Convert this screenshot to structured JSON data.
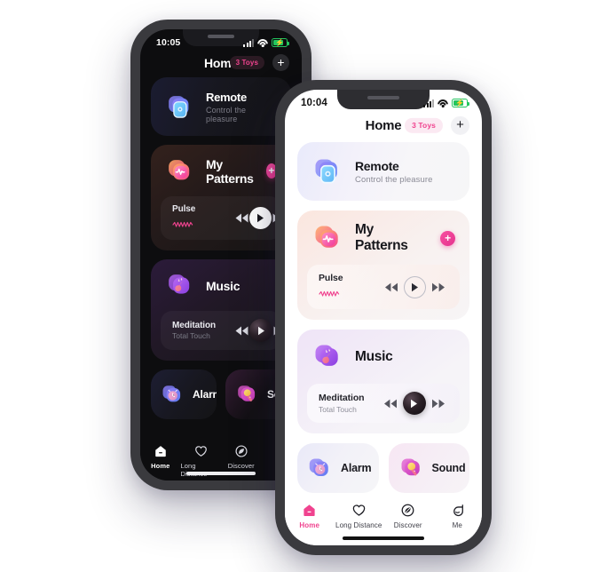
{
  "scene": {
    "background": "#ffffff",
    "accent_pink": "#f0438f",
    "description": "Two iPhone mockups of a toy-control app home screen, dark variant behind and light variant in front"
  },
  "phones": [
    {
      "id": "back-phone",
      "theme": "dark",
      "status": {
        "time": "10:05",
        "signal_icon": "cellular-bars-icon",
        "wifi_icon": "wifi-icon",
        "battery_icon": "battery-charging-icon"
      },
      "header": {
        "title": "Home",
        "badge": "3 Toys",
        "add_label": "+"
      }
    },
    {
      "id": "front-phone",
      "theme": "light",
      "status": {
        "time": "10:04",
        "signal_icon": "cellular-bars-icon",
        "wifi_icon": "wifi-icon",
        "battery_icon": "battery-charging-icon"
      },
      "header": {
        "title": "Home",
        "badge": "3 Toys",
        "add_label": "+"
      }
    }
  ],
  "cards": {
    "remote": {
      "title": "Remote",
      "subtitle": "Control the pleasure",
      "icon": "remote-device-icon"
    },
    "patterns": {
      "title": "My Patterns",
      "icon": "pulse-heartbeat-icon",
      "add_label": "+",
      "player": {
        "name": "Pulse",
        "wave_icon": "waveform-icon",
        "prev_icon": "rewind-icon",
        "play_icon": "play-icon",
        "next_icon": "fast-forward-icon"
      }
    },
    "music": {
      "title": "Music",
      "icon": "music-guitar-icon",
      "player": {
        "name": "Meditation",
        "subtitle": "Total Touch",
        "prev_icon": "rewind-icon",
        "play_icon": "play-icon",
        "next_icon": "fast-forward-icon"
      }
    },
    "alarm": {
      "title": "Alarm",
      "icon": "alarm-clock-icon"
    },
    "sound": {
      "title": "Sound",
      "icon": "microphone-icon"
    }
  },
  "tabs": [
    {
      "label": "Home",
      "icon": "home-icon",
      "active": true
    },
    {
      "label": "Long Distance",
      "icon": "heart-icon",
      "active": false
    },
    {
      "label": "Discover",
      "icon": "leaf-compass-icon",
      "active": false
    },
    {
      "label": "Me",
      "icon": "face-icon",
      "active": false
    }
  ]
}
